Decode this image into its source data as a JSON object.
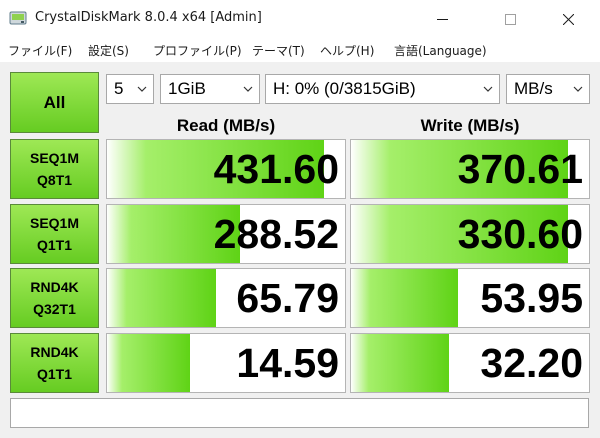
{
  "window": {
    "title": "CrystalDiskMark 8.0.4 x64 [Admin]"
  },
  "menu": [
    "ファイル(F)",
    "設定(S)",
    "プロファイル(P)",
    "テーマ(T)",
    "ヘルプ(H)",
    "言語(Language)"
  ],
  "controls": {
    "all_label": "All",
    "count": "5",
    "size": "1GiB",
    "drive": "H: 0% (0/3815GiB)",
    "unit": "MB/s"
  },
  "headers": {
    "read": "Read (MB/s)",
    "write": "Write (MB/s)"
  },
  "tests": [
    {
      "line1": "SEQ1M",
      "line2": "Q8T1",
      "read": "431.60",
      "write": "370.61",
      "read_fill": 0.91,
      "write_fill": 0.91
    },
    {
      "line1": "SEQ1M",
      "line2": "Q1T1",
      "read": "288.52",
      "write": "330.60",
      "read_fill": 0.56,
      "write_fill": 0.91
    },
    {
      "line1": "RND4K",
      "line2": "Q32T1",
      "read": "65.79",
      "write": "53.95",
      "read_fill": 0.46,
      "write_fill": 0.45
    },
    {
      "line1": "RND4K",
      "line2": "Q1T1",
      "read": "14.59",
      "write": "32.20",
      "read_fill": 0.35,
      "write_fill": 0.41
    }
  ],
  "comment": "",
  "colors": {
    "button_green": "#66cc22",
    "bar_green": "#5fd316"
  }
}
